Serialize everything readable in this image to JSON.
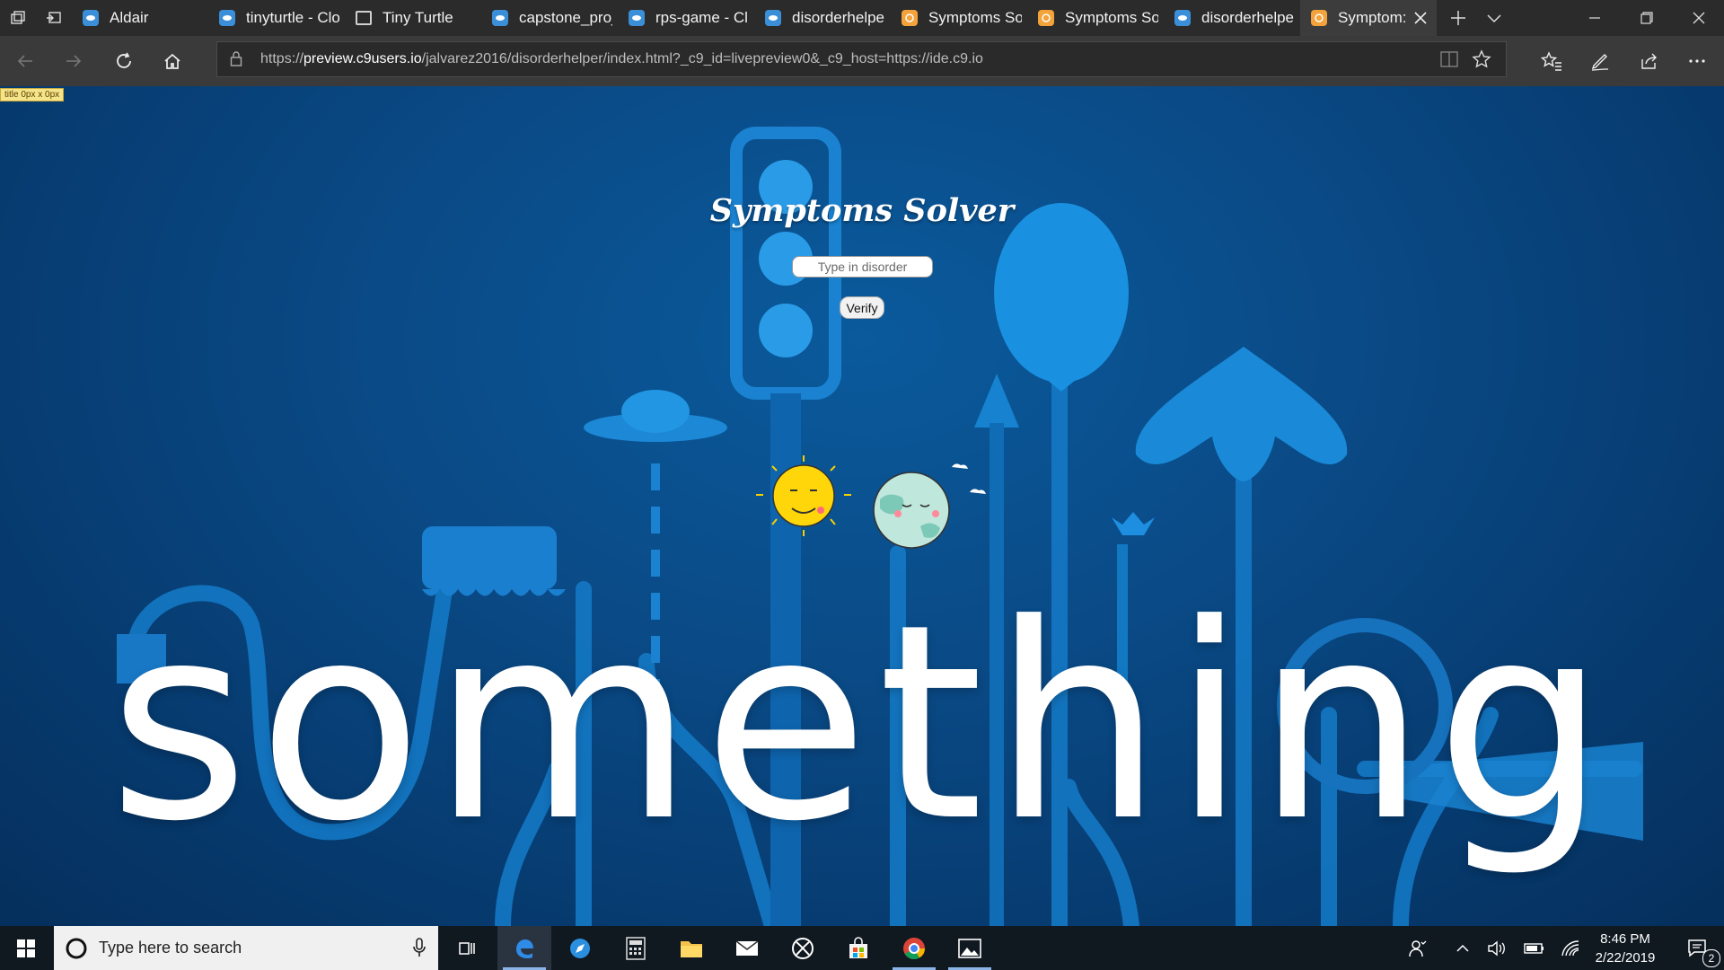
{
  "browser": {
    "tabs": [
      {
        "title": "Aldair",
        "icon": "c9-icon",
        "active": false
      },
      {
        "title": "tinyturtle - Clo",
        "icon": "c9-icon",
        "active": false
      },
      {
        "title": "Tiny Turtle",
        "icon": "page-icon",
        "active": false
      },
      {
        "title": "capstone_proj",
        "icon": "c9-icon",
        "active": false
      },
      {
        "title": "rps-game - Cl",
        "icon": "c9-icon",
        "active": false
      },
      {
        "title": "disorderhelpe",
        "icon": "c9-icon",
        "active": false
      },
      {
        "title": "Symptoms So",
        "icon": "symptoms-icon",
        "active": false
      },
      {
        "title": "Symptoms So",
        "icon": "symptoms-icon",
        "active": false
      },
      {
        "title": "disorderhelpe",
        "icon": "c9-icon",
        "active": false
      },
      {
        "title": "Symptom:",
        "icon": "symptoms-icon",
        "active": true
      }
    ],
    "url_prefix": "https://",
    "url_host": "preview.c9users.io",
    "url_rest": "/jalvarez2016/disorderhelper/index.html?_c9_id=livepreview0&_c9_host=https://ide.c9.io"
  },
  "page": {
    "dev_badge": "title 0px x 0px",
    "heading": "Symptoms Solver",
    "input_placeholder": "Type in disorder",
    "verify_label": "Verify",
    "big_word": "something"
  },
  "taskbar": {
    "search_placeholder": "Type here to search",
    "time": "8:46 PM",
    "date": "2/22/2019",
    "notification_count": "2"
  },
  "colors": {
    "page_bg": "#0a4a86",
    "accent": "#1e8ad6",
    "taskbar_bg": "#101820"
  }
}
